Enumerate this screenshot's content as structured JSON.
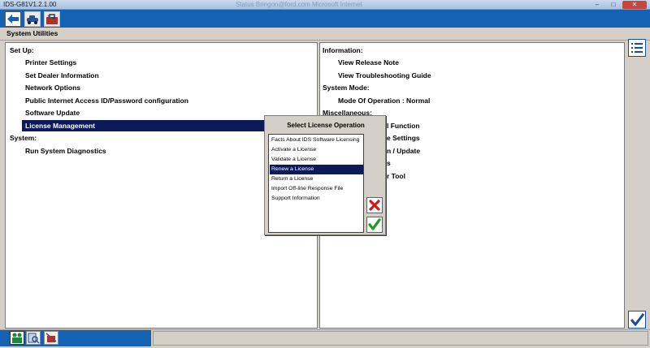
{
  "window": {
    "title": "IDS-G81V1.2.1.00",
    "faded_title": "Status   Bringon@ford.com   Microsoft Internet",
    "minimize": "–",
    "maximize": "□",
    "close": "✕"
  },
  "header": {
    "section_title": "System Utilities"
  },
  "left": {
    "setup_header": "Set Up:",
    "setup_items": [
      "Printer Settings",
      "Set Dealer Information",
      "Network Options",
      "Public Internet Access ID/Password configuration",
      "Software Update",
      "License Management"
    ],
    "system_header": "System:",
    "system_items": [
      "Run System Diagnostics"
    ]
  },
  "right": {
    "info_header": "Information:",
    "info_items": [
      "View Release Note",
      "View Troubleshooting Guide"
    ],
    "mode_header": "System Mode:",
    "mode_items": [
      "Mode Of Operation : Normal"
    ],
    "misc_header": "Miscellaneous:",
    "misc_items": [
      "l Function",
      "e Settings",
      "n / Update",
      "s",
      "r Tool"
    ]
  },
  "dialog": {
    "title": "Select License Operation",
    "options": [
      "Facts About IDS Software Licensing",
      "Activate a License",
      "Validate a License",
      "Renew a License",
      "Return a License",
      "Import Off-line Response File",
      "Support Information"
    ],
    "selected": "Renew a License"
  },
  "colors": {
    "toolbar_blue": "#1462b4",
    "selection_navy": "#0c1a5a",
    "cancel_red": "#cc1a1a",
    "ok_green": "#1f9a1f"
  },
  "icons": {
    "back": "back-arrow-icon",
    "vehicle": "vehicle-icon",
    "toolbox": "toolbox-icon",
    "list": "list-icon",
    "ok": "checkmark-icon",
    "cancel": "cross-icon"
  }
}
